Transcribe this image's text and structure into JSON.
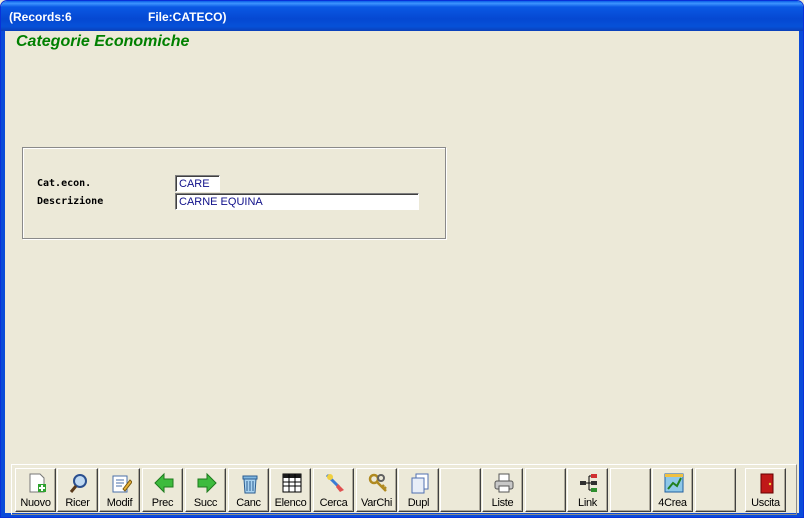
{
  "titlebar": {
    "records": "(Records:6",
    "file": "File:CATECO)"
  },
  "form": {
    "title": "Categorie Economiche",
    "fields": {
      "cat_econ": {
        "label": "Cat.econ.",
        "value": "CARE"
      },
      "descrizione": {
        "label": "Descrizione",
        "value": "CARNE EQUINA"
      }
    }
  },
  "toolbar": {
    "buttons": [
      {
        "label": "Nuovo",
        "icon": "new-record-icon"
      },
      {
        "label": "Ricer",
        "icon": "search-icon"
      },
      {
        "label": "Modif",
        "icon": "edit-icon"
      },
      {
        "label": "Prec",
        "icon": "arrow-left-icon"
      },
      {
        "label": "Succ",
        "icon": "arrow-right-icon"
      },
      {
        "label": "Canc",
        "icon": "trash-icon"
      },
      {
        "label": "Elenco",
        "icon": "table-icon"
      },
      {
        "label": "Cerca",
        "icon": "find-icon"
      },
      {
        "label": "VarChi",
        "icon": "keys-icon"
      },
      {
        "label": "Dupl",
        "icon": "duplicate-icon"
      },
      {
        "label": "",
        "icon": ""
      },
      {
        "label": "Liste",
        "icon": "printer-icon"
      },
      {
        "label": "",
        "icon": ""
      },
      {
        "label": "Link",
        "icon": "link-tree-icon"
      },
      {
        "label": "",
        "icon": ""
      },
      {
        "label": "4Crea",
        "icon": "chart-create-icon"
      },
      {
        "label": "",
        "icon": ""
      },
      {
        "label": "Uscita",
        "icon": "exit-door-icon"
      }
    ]
  },
  "colors": {
    "title_green": "#008000",
    "field_text": "#10108A",
    "titlebar_blue": "#0548D2"
  }
}
